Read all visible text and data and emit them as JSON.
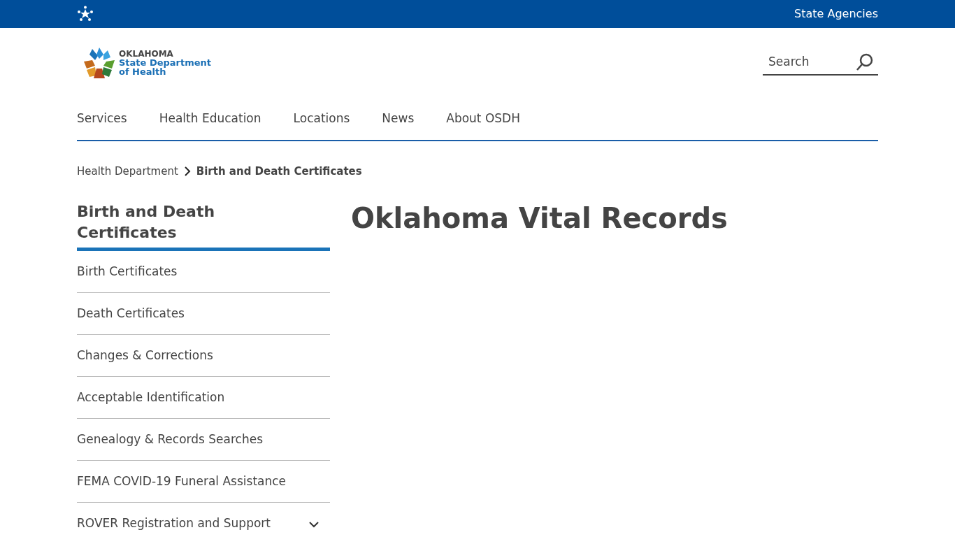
{
  "top_bar": {
    "link": "State Agencies"
  },
  "logo": {
    "line_1": "OKLAHOMA",
    "line_2": "State Department",
    "line_3": "of Health"
  },
  "search": {
    "placeholder": "Search"
  },
  "nav": [
    {
      "label": "Services"
    },
    {
      "label": "Health Education"
    },
    {
      "label": "Locations"
    },
    {
      "label": "News"
    },
    {
      "label": "About OSDH"
    }
  ],
  "breadcrumb": [
    {
      "label": "Health Department",
      "current": false
    },
    {
      "label": "Birth and Death Certificates",
      "current": true
    }
  ],
  "sidebar": {
    "title": "Birth and Death Certificates",
    "items": [
      {
        "label": "Birth Certificates"
      },
      {
        "label": "Death Certificates"
      },
      {
        "label": "Changes & Corrections"
      },
      {
        "label": "Acceptable Identification"
      },
      {
        "label": "Genealogy & Records Searches"
      },
      {
        "label": "FEMA COVID-19 Funeral Assistance"
      },
      {
        "label": "ROVER Registration and Support",
        "expanded": false
      }
    ]
  },
  "page_title": "Oklahoma Vital Records"
}
